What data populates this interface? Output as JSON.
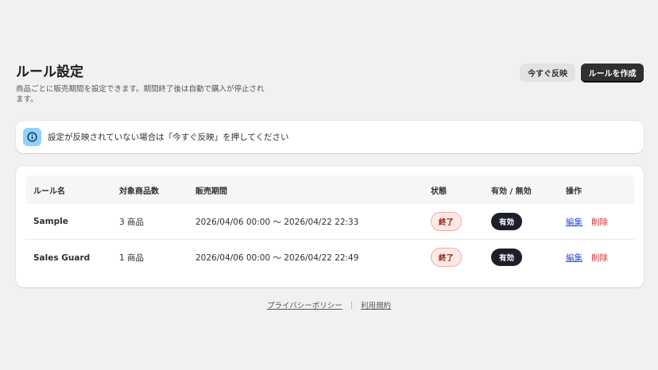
{
  "header": {
    "title": "ルール設定",
    "subtitle": "商品ごとに販売期間を設定できます。期間終了後は自動で購入が停止されます。",
    "apply_now_label": "今すぐ反映",
    "create_rule_label": "ルールを作成"
  },
  "banner": {
    "text": "設定が反映されていない場合は「今すぐ反映」を押してください",
    "icon": "info-icon",
    "icon_bg": "#91d0ff"
  },
  "table": {
    "columns": [
      "ルール名",
      "対象商品数",
      "販売期間",
      "状態",
      "有効 / 無効",
      "操作"
    ],
    "rows": [
      {
        "name": "Sample",
        "count": "3 商品",
        "period": "2026/04/06 00:00 〜 2026/04/22 22:33",
        "status": "終了",
        "active": "有効",
        "edit": "編集",
        "delete": "削除"
      },
      {
        "name": "Sales Guard",
        "count": "1 商品",
        "period": "2026/04/06 00:00 〜 2026/04/22 22:49",
        "status": "終了",
        "active": "有効",
        "edit": "編集",
        "delete": "削除"
      }
    ]
  },
  "footer": {
    "privacy": "プライバシーポリシー",
    "separator": "|",
    "terms": "利用規約"
  },
  "colors": {
    "page_bg": "#f1f1f1",
    "primary_button": "#303030",
    "status_ended_bg": "#fee9e8",
    "status_ended_text": "#8e1f0b",
    "active_badge_bg": "#1c1f2a",
    "edit_link": "#2c56d8",
    "delete_link": "#d12f2f"
  }
}
